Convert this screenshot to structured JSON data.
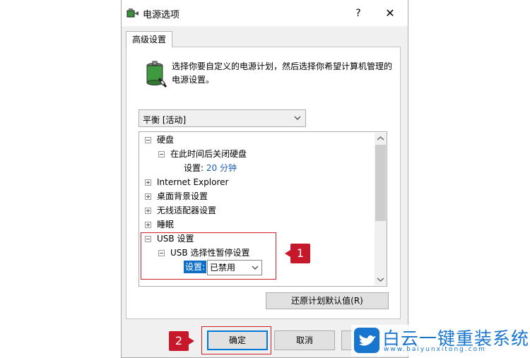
{
  "window": {
    "title": "电源选项",
    "help_label": "?",
    "close_label": "✕"
  },
  "tab": {
    "label": "高级设置"
  },
  "description": "选择你要自定义的电源计划，然后选择你希望计算机管理的电源设置。",
  "plan_select": {
    "value": "平衡 [活动]"
  },
  "tree": {
    "hard_disk": "硬盘",
    "turn_off_disk": "在此时间后关闭硬盘",
    "disk_setting_label": "设置:",
    "disk_setting_value": "20 分钟",
    "internet_explorer": "Internet Explorer",
    "desktop_background": "桌面背景设置",
    "wireless_adapter": "无线适配器设置",
    "sleep": "睡眠",
    "usb_settings": "USB 设置",
    "usb_selective_suspend": "USB 选择性暂停设置",
    "usb_setting_label": "设置:",
    "usb_setting_value": "已禁用"
  },
  "buttons": {
    "restore": "还原计划默认值(R)",
    "ok": "确定",
    "cancel": "取消",
    "apply": "A)"
  },
  "annotations": {
    "callout_1": "1",
    "callout_2": "2"
  },
  "watermark": {
    "text": "白云一键重装系统",
    "url": "www.baiyunxitong.com"
  },
  "colors": {
    "highlight": "#0f6fc6",
    "annotation_red": "#c6182a",
    "link_blue": "#1c5fb1"
  }
}
